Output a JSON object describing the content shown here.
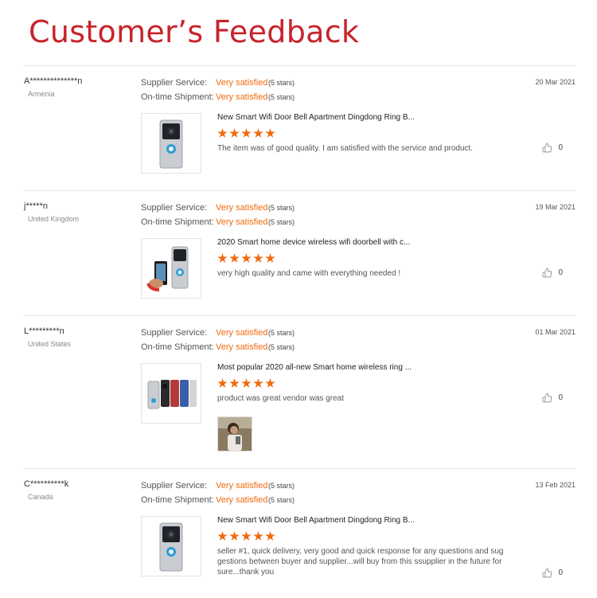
{
  "page": {
    "title": "Customer’s Feedback"
  },
  "labels": {
    "supplier_service": "Supplier Service:",
    "ontime_shipment": "On-time Shipment:"
  },
  "colors": {
    "title": "#c8232c",
    "accent": "#f06a0e",
    "divider": "#e3e3e3"
  },
  "reviews": [
    {
      "buyer": "A**************n",
      "country": "Armenia",
      "date": "20 Mar 2021",
      "supplier_service": {
        "value": "Very satisfied",
        "stars_text": "(5 stars)"
      },
      "ontime_shipment": {
        "value": "Very satisfied",
        "stars_text": "(5 stars)"
      },
      "product_title": "New Smart Wifi Door Bell Apartment Dingdong Ring B...",
      "product_image": "doorbell-front-icon",
      "rating": 5,
      "comment": "The item was of good quality. I am satisfied with the service and product.",
      "likes": "0"
    },
    {
      "buyer": "j*****n",
      "country": "United Kingdom",
      "date": "19 Mar 2021",
      "supplier_service": {
        "value": "Very satisfied",
        "stars_text": "(5 stars)"
      },
      "ontime_shipment": {
        "value": "Very satisfied",
        "stars_text": "(5 stars)"
      },
      "product_title": "2020 Smart home device wireless wifi doorbell with c...",
      "product_image": "doorbell-with-phone-icon",
      "rating": 5,
      "comment": "very high quality and came with everything needed !",
      "likes": "0"
    },
    {
      "buyer": "L*********n",
      "country": "United States",
      "date": "01 Mar 2021",
      "supplier_service": {
        "value": "Very satisfied",
        "stars_text": "(5 stars)"
      },
      "ontime_shipment": {
        "value": "Very satisfied",
        "stars_text": "(5 stars)"
      },
      "product_title": "Most popular 2020 all-new Smart home wireless ring ...",
      "product_image": "doorbell-color-variants-icon",
      "rating": 5,
      "comment": "product was great vendor was great",
      "likes": "0",
      "buyer_photo": "buyer-photo-thumbnail"
    },
    {
      "buyer": "C**********k",
      "country": "Canada",
      "date": "13 Feb 2021",
      "supplier_service": {
        "value": "Very satisfied",
        "stars_text": "(5 stars)"
      },
      "ontime_shipment": {
        "value": "Very satisfied",
        "stars_text": "(5 stars)"
      },
      "product_title": "New Smart Wifi Door Bell Apartment Dingdong Ring B...",
      "product_image": "doorbell-front-icon",
      "rating": 5,
      "comment": "seller #1, quick delivery, very good and quick response for any questions and sug gestions between buyer and supplier...will buy from this ssupplier in the future for sure...thank you",
      "likes": "0"
    }
  ]
}
